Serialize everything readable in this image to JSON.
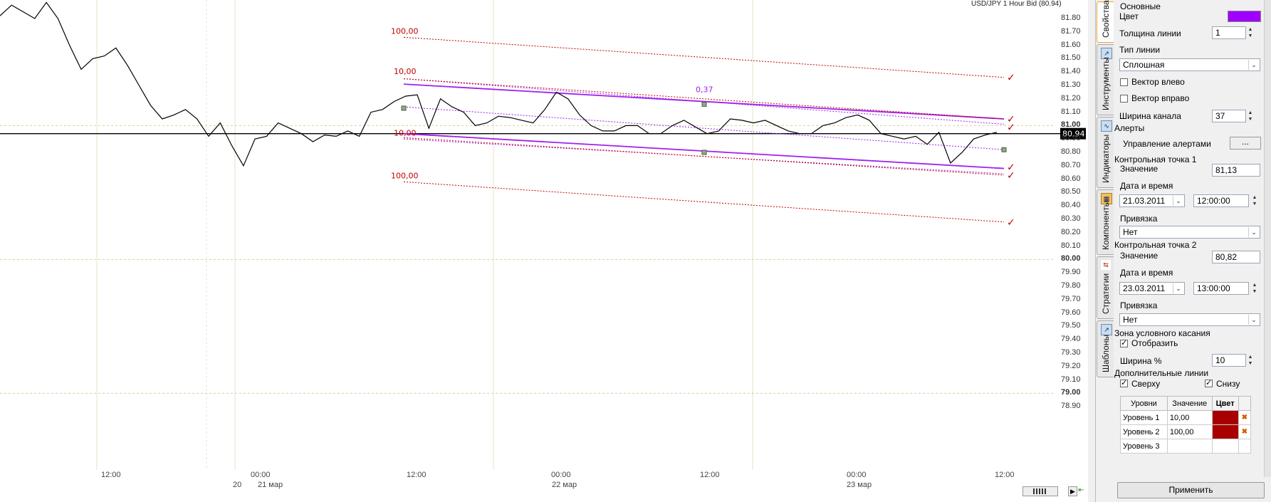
{
  "chart": {
    "title": "USD/JPY 1 Hour Bid (80.94)",
    "current_price": "80.94",
    "price_labels": [
      "81.80",
      "81.70",
      "81.60",
      "81.50",
      "81.40",
      "81.30",
      "81.20",
      "81.10",
      "81.00",
      "80.90",
      "80.80",
      "80.70",
      "80.60",
      "80.50",
      "80.40",
      "80.30",
      "80.20",
      "80.10",
      "80.00",
      "79.90",
      "79.80",
      "79.70",
      "79.60",
      "79.50",
      "79.40",
      "79.30",
      "79.20",
      "79.10",
      "79.00",
      "78.90"
    ],
    "bold_prices": [
      "81.00",
      "80.00",
      "79.00"
    ],
    "time_labels": [
      "12:00",
      "00:00",
      "12:00",
      "00:00",
      "12:00",
      "00:00",
      "12:00"
    ],
    "date_labels": [
      "20",
      "21 мар",
      "22 мар",
      "23 мар"
    ],
    "level_labels": [
      "100,00",
      "10,00",
      "10,00",
      "100,00"
    ],
    "width_label": "0,37",
    "colors": {
      "channel": "#a020f0",
      "level": "#c00000",
      "price": "#000000"
    },
    "price_series": [
      81.82,
      81.9,
      81.85,
      81.8,
      81.92,
      81.8,
      81.6,
      81.42,
      81.5,
      81.52,
      81.58,
      81.45,
      81.3,
      81.15,
      81.05,
      81.08,
      81.12,
      81.05,
      80.92,
      81.02,
      80.85,
      80.7,
      80.9,
      80.92,
      81.02,
      80.98,
      80.94,
      80.88,
      80.93,
      80.92,
      80.96,
      80.92,
      81.1,
      81.12,
      81.18,
      81.22,
      81.23,
      80.98,
      81.2,
      81.14,
      81.1,
      81.0,
      81.02,
      81.07,
      81.06,
      81.04,
      81.02,
      81.12,
      81.25,
      81.2,
      81.08,
      81.0,
      80.96,
      80.96,
      81.0,
      81.0,
      80.94,
      80.94,
      81.0,
      81.04,
      80.99,
      80.94,
      80.96,
      81.05,
      81.04,
      81.02,
      81.04,
      81.0,
      80.96,
      80.94,
      80.94,
      81.0,
      81.02,
      81.06,
      81.08,
      81.04,
      80.94,
      80.92,
      80.9,
      80.92,
      80.86,
      80.95,
      80.72,
      80.8,
      80.9,
      80.93,
      80.95
    ]
  },
  "tabs": [
    "Свойства",
    "Инструменты",
    "Индикаторы",
    "Компоненты",
    "Стратегии",
    "Шаблоны"
  ],
  "panel": {
    "section_main": "Основные",
    "color_label": "Цвет",
    "color_value": "#a000ff",
    "line_width_label": "Толщина линии",
    "line_width_value": "1",
    "line_type_label": "Тип линии",
    "line_type_value": "Сплошная",
    "vector_left_label": "Вектор влево",
    "vector_right_label": "Вектор вправо",
    "channel_width_label": "Ширина канала",
    "channel_width_value": "37",
    "section_alerts": "Алерты",
    "alerts_manage_label": "Управление алертами",
    "alerts_button": "...",
    "section_cp1": "Контрольная точка 1",
    "cp1_value_label": "Значение",
    "cp1_value": "81,13",
    "cp1_datetime_label": "Дата и время",
    "cp1_date": "21.03.2011",
    "cp1_time": "12:00:00",
    "cp1_binding_label": "Привязка",
    "cp1_binding_value": "Нет",
    "section_cp2": "Контрольная точка 2",
    "cp2_value_label": "Значение",
    "cp2_value": "80,82",
    "cp2_datetime_label": "Дата и время",
    "cp2_date": "23.03.2011",
    "cp2_time": "13:00:00",
    "cp2_binding_label": "Привязка",
    "cp2_binding_value": "Нет",
    "section_zone": "Зона условного касания",
    "zone_show_label": "Отобразить",
    "zone_width_label": "Ширина %",
    "zone_width_value": "10",
    "section_extra": "Дополнительные линии",
    "extra_top_label": "Сверху",
    "extra_bottom_label": "Снизу",
    "table_headers": [
      "Уровни",
      "Значение",
      "Цвет"
    ],
    "levels": [
      {
        "name": "Уровень 1",
        "value": "10,00",
        "color": "#a80000"
      },
      {
        "name": "Уровень 2",
        "value": "100,00",
        "color": "#a80000"
      },
      {
        "name": "Уровень 3",
        "value": "",
        "color": ""
      }
    ],
    "apply_button": "Применить"
  }
}
